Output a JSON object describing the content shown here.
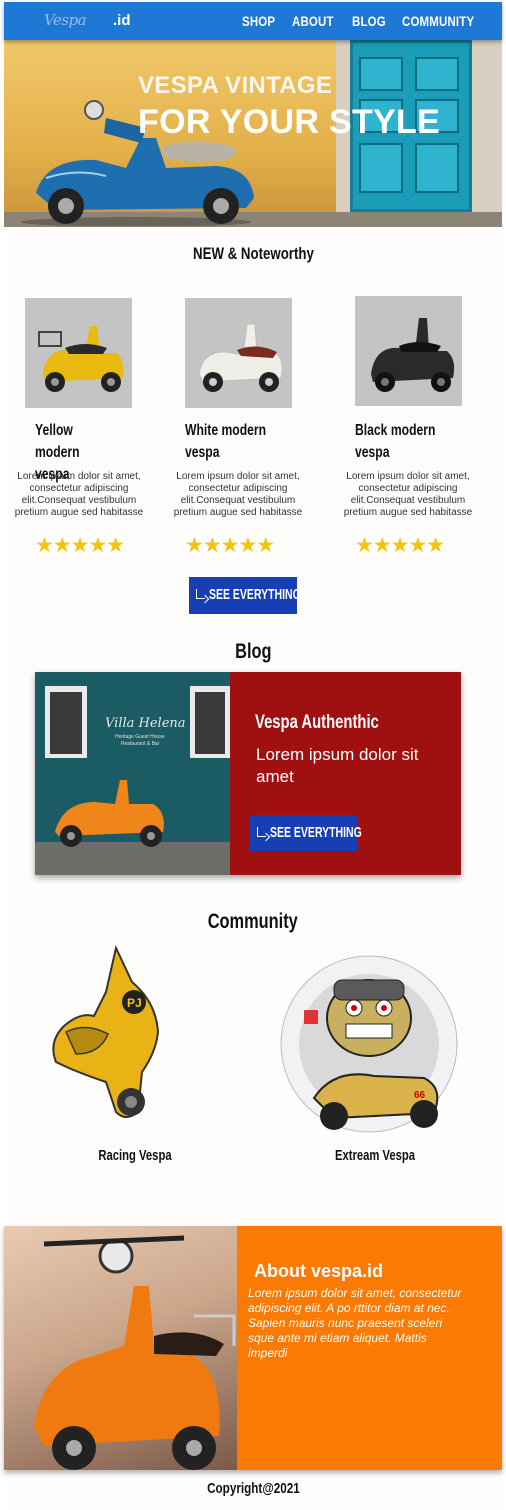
{
  "nav": {
    "logo": "Vespa",
    "logo_suffix": ".id",
    "links": [
      "SHOP",
      "ABOUT",
      "BLOG",
      "COMMUNITY"
    ]
  },
  "hero": {
    "line1": "VESPA VINTAGE",
    "line2": "FOR YOUR STYLE"
  },
  "products": {
    "heading": "NEW & Noteworthy",
    "items": [
      {
        "name_line1": "Yellow modern",
        "name_line2": "vespa",
        "desc": "Lorem ipsum dolor sit amet,  consectetur adipiscing elit.Consequat vestibulum pretium augue sed habitasse",
        "stars": "★★★★★",
        "color": "#e9b90f"
      },
      {
        "name_line1": "White modern",
        "name_line2": "vespa",
        "desc": "Lorem ipsum dolor sit amet,  consectetur adipiscing elit.Consequat vestibulum pretium augue sed habitasse",
        "stars": "★★★★★",
        "color": "#efefe8"
      },
      {
        "name_line1": "Black modern",
        "name_line2": "vespa",
        "desc": "Lorem ipsum dolor sit amet,  consectetur adipiscing elit.Consequat vestibulum pretium augue sed habitasse",
        "stars": "★★★★★",
        "color": "#2a2a2a"
      }
    ],
    "button": "SEE EVERYTHING"
  },
  "blog": {
    "heading": "Blog",
    "sign_line1": "Villa Helena",
    "sign_line2": "Heritage Guest House",
    "sign_line3": "Restaurant & Bar",
    "title": "Vespa Authenthic",
    "subtitle": "Lorem ipsum dolor sit amet",
    "button": "SEE EVERYTHING"
  },
  "community": {
    "heading": "Community",
    "items": [
      {
        "label": "Racing Vespa",
        "badge": "PJ"
      },
      {
        "label": "Extream Vespa",
        "badge": "66"
      }
    ]
  },
  "about": {
    "title": "About vespa.id",
    "body": "Lorem ipsum dolor sit amet, consectetur adipiscing elit. A po rttitor diam at nec. Sapien mauris nunc praesent sceleri sque ante mi etiam aliquet. Mattis imperdi"
  },
  "footer": {
    "copyright": "Copyright@2021"
  },
  "colors": {
    "nav": "#1e78d6",
    "button": "#173fb3",
    "blog_card": "#a01010",
    "about": "#fb7a04",
    "stars": "#f1c40f"
  }
}
